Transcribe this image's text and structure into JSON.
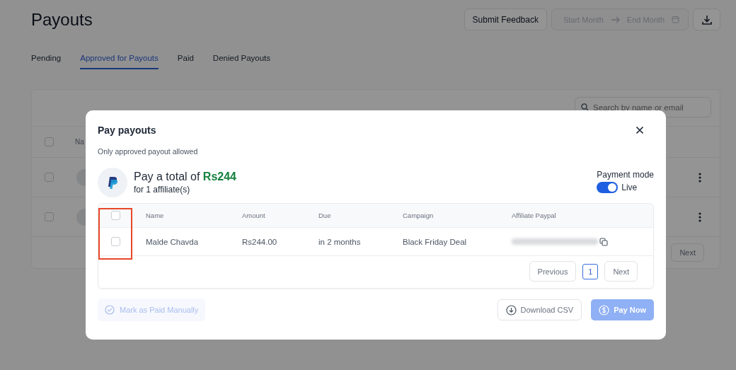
{
  "page": {
    "title": "Payouts",
    "feedback_button": "Submit Feedback",
    "date_range": {
      "start_placeholder": "Start Month",
      "end_placeholder": "End Month",
      "disabled": true
    }
  },
  "tabs": [
    {
      "label": "Pending",
      "selected": false
    },
    {
      "label": "Approved for Payouts",
      "selected": true
    },
    {
      "label": "Paid",
      "selected": false
    },
    {
      "label": "Denied Payouts",
      "selected": false
    }
  ],
  "list": {
    "search_placeholder": "Search by name or email",
    "header_checked": false,
    "column_1": "Na",
    "rows": [
      {
        "checked": false
      },
      {
        "checked": false
      }
    ],
    "next_button": "Next"
  },
  "modal": {
    "title": "Pay payouts",
    "note": "Only approved payout allowed",
    "total_prefix": "Pay a total of",
    "total": "Rs244",
    "affiliates": "for 1 affiliate(s)",
    "payment_mode_label": "Payment mode",
    "live": {
      "label": "Live",
      "on": true
    },
    "select_all_checked": false,
    "columns": [
      "Name",
      "Amount",
      "Due",
      "Campaign",
      "Affiliate Paypal"
    ],
    "rows": [
      {
        "checked": false,
        "name": "Malde Chavda",
        "amount": "Rs244.00",
        "due": "in 2 months",
        "campaign": "Black Friday Deal"
      }
    ],
    "pagination": {
      "previous": "Previous",
      "pages": [
        {
          "label": "1",
          "selected": true
        }
      ],
      "next": "Next"
    },
    "mark_paid_button": {
      "label": "Mark as Paid Manually",
      "disabled": true
    },
    "download_button": "Download CSV",
    "pay_button": {
      "label": "Pay Now",
      "disabled": true
    }
  }
}
